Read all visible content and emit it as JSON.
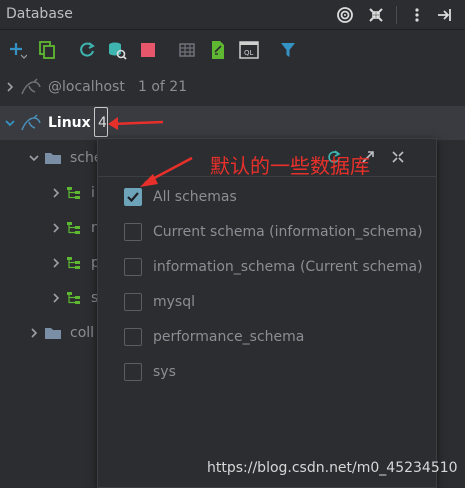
{
  "window": {
    "title": "Database"
  },
  "titlebar_icons": [
    "target-icon",
    "collapse-icon",
    "more-vert-icon",
    "hide-panel-icon"
  ],
  "toolbar": {
    "icons": [
      "add-icon",
      "copy-icon",
      "refresh-icon",
      "schema-icon",
      "stop-icon",
      "table-icon",
      "edit-file-icon",
      "console-icon",
      "filter-icon"
    ],
    "console_label": "QL"
  },
  "tree": {
    "localhost": {
      "label": "@localhost",
      "count": "1 of 21"
    },
    "linux": {
      "label": "Linux",
      "count": "4"
    },
    "schemas_folder": {
      "label": "sche"
    },
    "schema_items": [
      {
        "label": "i"
      },
      {
        "label": "n"
      },
      {
        "label": "p"
      },
      {
        "label": "s"
      }
    ],
    "collations_folder": {
      "label": "coll"
    }
  },
  "popup": {
    "options": [
      {
        "label": "All schemas",
        "checked": true
      },
      {
        "label": "Current schema (information_schema)",
        "checked": false
      },
      {
        "label": "information_schema  (Current schema)",
        "checked": false
      },
      {
        "label": "mysql",
        "checked": false
      },
      {
        "label": "performance_schema",
        "checked": false
      },
      {
        "label": "sys",
        "checked": false
      }
    ]
  },
  "annotation": {
    "text": "默认的一些数据库"
  },
  "watermark": {
    "text": "https://blog.csdn.net/m0_45234510"
  },
  "colors": {
    "background": "#2b2d30",
    "selected_row": "#393b40",
    "checkbox_checked": "#6ea4ba",
    "annotation_red": "#e8302b",
    "filter_blue": "#3592c4",
    "refresh_cyan": "#3fb5b2",
    "stop_pink": "#e8566b",
    "edit_green": "#5fb832"
  }
}
